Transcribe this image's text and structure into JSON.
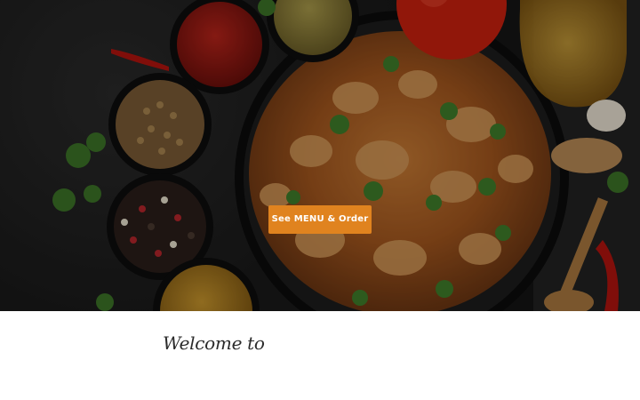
{
  "hero": {
    "cta_label": "See MENU & Order",
    "accent_color": "#e0831f",
    "image": "curry-and-spices-photo"
  },
  "content": {
    "welcome_text": "Welcome to"
  }
}
